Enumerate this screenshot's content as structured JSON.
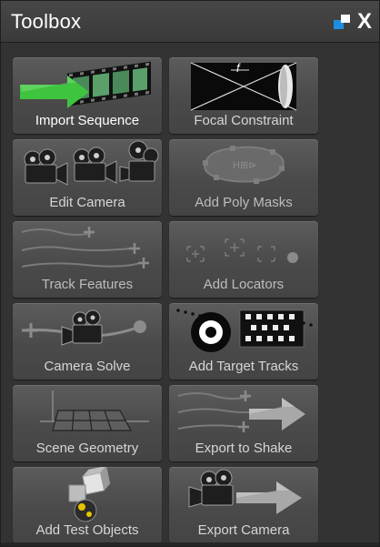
{
  "panel": {
    "title": "Toolbox",
    "float_icon": "float-window-icon",
    "close_label": "X"
  },
  "tools": [
    {
      "label": "Import Sequence",
      "icon": "import-sequence-icon",
      "state": "active"
    },
    {
      "label": "Focal Constraint",
      "icon": "focal-constraint-icon",
      "state": "normal"
    },
    {
      "label": "Edit Camera",
      "icon": "edit-camera-icon",
      "state": "normal"
    },
    {
      "label": "Add Poly Masks",
      "icon": "poly-mask-icon",
      "state": "dim"
    },
    {
      "label": "Track Features",
      "icon": "track-features-icon",
      "state": "dim"
    },
    {
      "label": "Add Locators",
      "icon": "locators-icon",
      "state": "dim"
    },
    {
      "label": "Camera Solve",
      "icon": "camera-solve-icon",
      "state": "normal"
    },
    {
      "label": "Add Target Tracks",
      "icon": "target-tracks-icon",
      "state": "normal"
    },
    {
      "label": "Scene Geometry",
      "icon": "scene-geometry-icon",
      "state": "normal"
    },
    {
      "label": "Export to Shake",
      "icon": "export-shake-icon",
      "state": "normal"
    },
    {
      "label": "Add Test Objects",
      "icon": "test-objects-icon",
      "state": "normal"
    },
    {
      "label": "Export Camera",
      "icon": "export-camera-icon",
      "state": "normal"
    }
  ],
  "colors": {
    "accent": "#1d8fe0",
    "arrow_green": "#3ec43e",
    "panel_bg": "#333333"
  }
}
